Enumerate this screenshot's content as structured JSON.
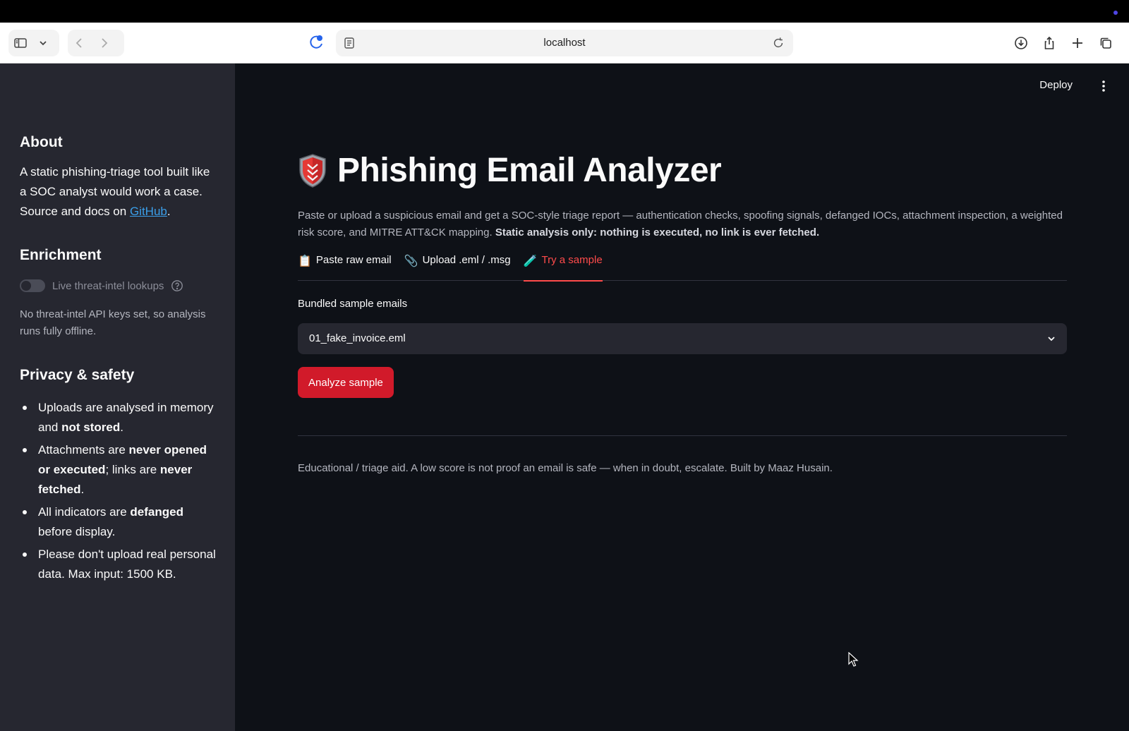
{
  "browser": {
    "url": "localhost"
  },
  "sidebar": {
    "about": {
      "heading": "About",
      "text_before_link": "A static phishing-triage tool built like a SOC analyst would work a case. Source and docs on ",
      "link_label": "GitHub",
      "text_after_link": "."
    },
    "enrichment": {
      "heading": "Enrichment",
      "toggle_label": "Live threat-intel lookups",
      "toggle_on": false,
      "note": "No threat-intel API keys set, so analysis runs fully offline."
    },
    "privacy": {
      "heading": "Privacy & safety",
      "items": [
        {
          "t1": "Uploads are analysed in memory and ",
          "b1": "not stored",
          "t2": ".",
          "b2": "",
          "t3": ""
        },
        {
          "t1": "Attachments are ",
          "b1": "never opened or executed",
          "t2": "; links are ",
          "b2": "never fetched",
          "t3": "."
        },
        {
          "t1": "All indicators are ",
          "b1": "defanged",
          "t2": " before display.",
          "b2": "",
          "t3": ""
        },
        {
          "t1": "Please don't upload real personal data. Max input: 1500 KB.",
          "b1": "",
          "t2": "",
          "b2": "",
          "t3": ""
        }
      ]
    }
  },
  "header": {
    "deploy_label": "Deploy"
  },
  "main": {
    "title": "Phishing Email Analyzer",
    "description": "Paste or upload a suspicious email and get a SOC-style triage report — authentication checks, spoofing signals, defanged IOCs, attachment inspection, a weighted risk score, and MITRE ATT&CK mapping. ",
    "description_bold": "Static analysis only: nothing is executed, no link is ever fetched.",
    "tabs": [
      {
        "icon": "📋",
        "label": "Paste raw email",
        "active": false
      },
      {
        "icon": "📎",
        "label": "Upload .eml / .msg",
        "active": false
      },
      {
        "icon": "🧪",
        "label": "Try a sample",
        "active": true
      }
    ],
    "select_label": "Bundled sample emails",
    "select_value": "01_fake_invoice.eml",
    "analyze_button": "Analyze sample",
    "footer": "Educational / triage aid. A low score is not proof an email is safe — when in doubt, escalate. Built by Maaz Husain."
  },
  "colors": {
    "accent": "#ff4b4b",
    "button": "#d11a2a",
    "sidebar_bg": "#262730",
    "main_bg": "#0e1117"
  }
}
